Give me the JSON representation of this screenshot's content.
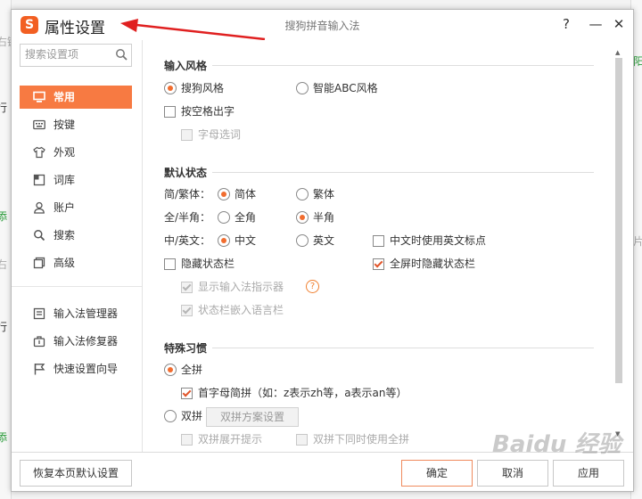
{
  "background": {
    "left_fragments": [
      "右键",
      "行",
      "添",
      "右",
      "行",
      "添"
    ],
    "right_fragments": [
      "阳",
      "片"
    ]
  },
  "window": {
    "title": "属性设置",
    "app_name": "搜狗拼音输入法",
    "logo_letter": "S",
    "help_label": "?",
    "minimize_label": "—",
    "close_label": "✕",
    "accent_color": "#f77a42"
  },
  "sidebar": {
    "search_placeholder": "搜索设置项",
    "items": [
      {
        "label": "常用",
        "icon": "monitor-icon",
        "active": true
      },
      {
        "label": "按键",
        "icon": "keyboard-icon"
      },
      {
        "label": "外观",
        "icon": "shirt-icon"
      },
      {
        "label": "词库",
        "icon": "book-icon"
      },
      {
        "label": "账户",
        "icon": "user-icon"
      },
      {
        "label": "搜索",
        "icon": "search-icon"
      },
      {
        "label": "高级",
        "icon": "advanced-icon"
      }
    ],
    "tools": [
      {
        "label": "输入法管理器",
        "icon": "manager-icon"
      },
      {
        "label": "输入法修复器",
        "icon": "repair-icon"
      },
      {
        "label": "快速设置向导",
        "icon": "flag-icon"
      }
    ]
  },
  "sections": {
    "style": {
      "title": "输入风格",
      "sogou": "搜狗风格",
      "abc": "智能ABC风格",
      "space_output": "按空格出字",
      "letter_select": "字母选词"
    },
    "default": {
      "title": "默认状态",
      "simp_label": "简/繁体：",
      "simp": "简体",
      "trad": "繁体",
      "width_label": "全/半角：",
      "full": "全角",
      "half": "半角",
      "lang_label": "中/英文：",
      "chinese": "中文",
      "english": "英文",
      "cn_en_punct": "中文时使用英文标点",
      "hide_status": "隐藏状态栏",
      "fullscreen_hide": "全屏时隐藏状态栏",
      "show_indicator": "显示输入法指示器",
      "embed_langbar": "状态栏嵌入语言栏"
    },
    "habit": {
      "title": "特殊习惯",
      "quanpin": "全拼",
      "initials": "首字母简拼（如：z表示zh等，a表示an等）",
      "shuangpin": "双拼",
      "shuangpin_scheme": "双拼方案设置",
      "shuangpin_hint": "双拼展开提示",
      "shuangpin_quanpin": "双拼下同时使用全拼"
    }
  },
  "footer": {
    "restore": "恢复本页默认设置",
    "ok": "确定",
    "cancel": "取消",
    "apply": "应用"
  },
  "watermark": "Baidu 经验"
}
